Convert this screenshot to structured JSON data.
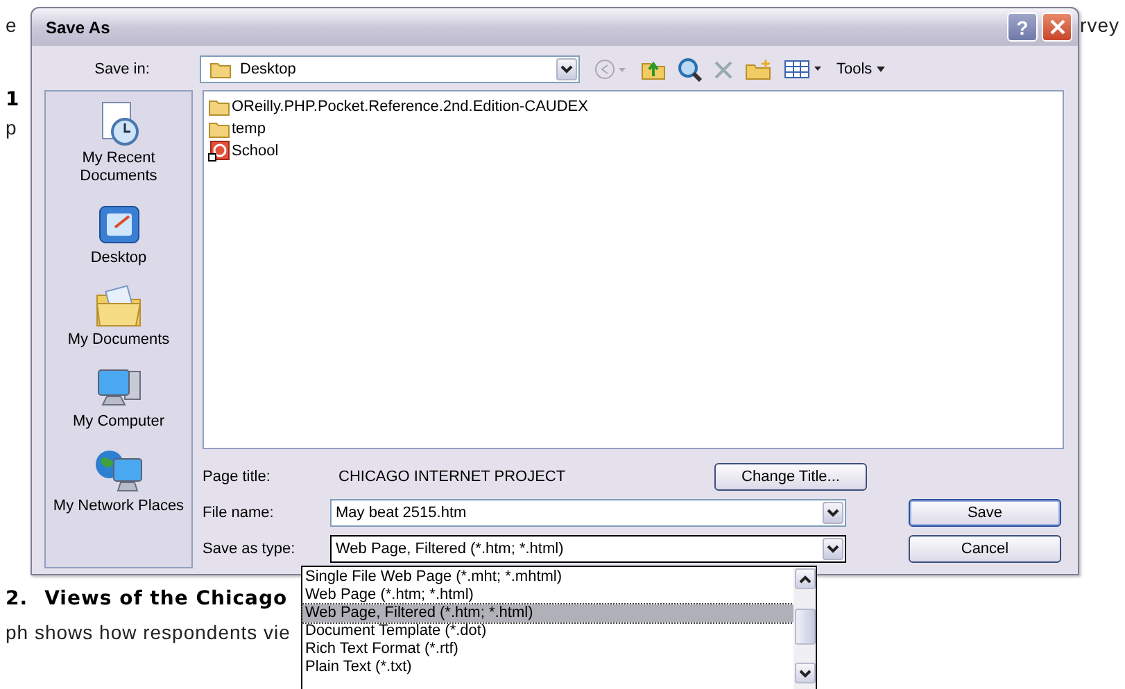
{
  "document": {
    "top_left": "e",
    "top_right": "rvey",
    "heading_1": "1",
    "para_1": "p",
    "heading_2_number": "2.",
    "heading_2": "Views of the Chicago",
    "para_2": "ph shows how respondents vie"
  },
  "window": {
    "title": "Save As",
    "help": "?"
  },
  "toolbar": {
    "label": "Save in:",
    "location": "Desktop",
    "tools": "Tools"
  },
  "places": [
    {
      "label": "My Recent Documents",
      "kind": "recent"
    },
    {
      "label": "Desktop",
      "kind": "desktop"
    },
    {
      "label": "My Documents",
      "kind": "documents"
    },
    {
      "label": "My Computer",
      "kind": "computer"
    },
    {
      "label": "My Network Places",
      "kind": "network"
    }
  ],
  "files": [
    {
      "name": "OReilly.PHP.Pocket.Reference.2nd.Edition-CAUDEX",
      "kind": "folder"
    },
    {
      "name": "temp",
      "kind": "folder"
    },
    {
      "name": "School",
      "kind": "shortcut"
    }
  ],
  "page_title": {
    "label": "Page title:",
    "value": "CHICAGO INTERNET PROJECT",
    "button": "Change Title..."
  },
  "file_name": {
    "label": "File name:",
    "value": "May beat 2515.htm"
  },
  "save_type": {
    "label": "Save as type:",
    "value": "Web Page, Filtered (*.htm; *.html)",
    "expanded": true,
    "options": [
      {
        "label": "Single File Web Page (*.mht; *.mhtml)",
        "selected": false
      },
      {
        "label": "Web Page (*.htm; *.html)",
        "selected": false
      },
      {
        "label": "Web Page, Filtered (*.htm; *.html)",
        "selected": true
      },
      {
        "label": "Document Template (*.dot)",
        "selected": false
      },
      {
        "label": "Rich Text Format (*.rtf)",
        "selected": false
      },
      {
        "label": "Plain Text (*.txt)",
        "selected": false
      }
    ]
  },
  "buttons": [
    {
      "label": "Save",
      "kind": "default"
    },
    {
      "label": "Cancel",
      "kind": "normal"
    }
  ]
}
